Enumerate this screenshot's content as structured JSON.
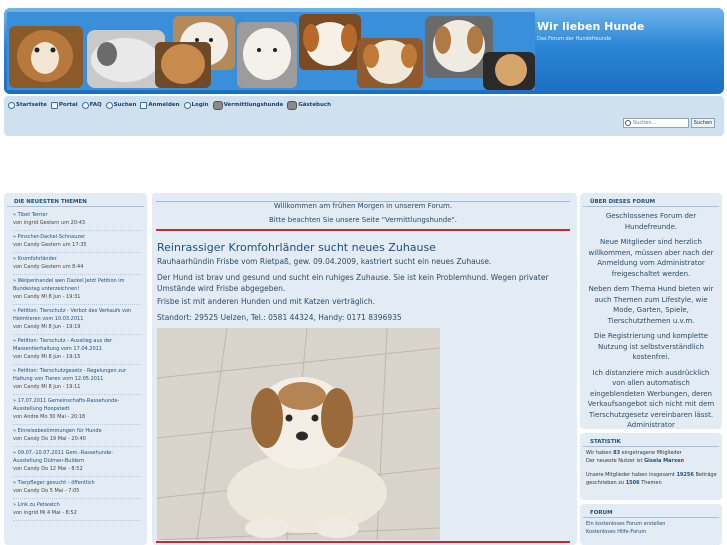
{
  "header": {
    "title": "Wir lieben Hunde",
    "description": "Das Forum der Hundefreunde"
  },
  "nav": {
    "items": [
      {
        "label": "Startseite",
        "icon": "home-icon"
      },
      {
        "label": "Portal",
        "icon": "portal-icon"
      },
      {
        "label": "FAQ",
        "icon": "help-icon"
      },
      {
        "label": "Suchen",
        "icon": "search-icon"
      },
      {
        "label": "Anmelden",
        "icon": "register-icon"
      },
      {
        "label": "Login",
        "icon": "login-icon"
      },
      {
        "label": "Vermittlungshunde",
        "icon": "dog-icon"
      },
      {
        "label": "Gästebuch",
        "icon": "dog-icon"
      }
    ],
    "search_placeholder": "Suchen...",
    "search_button": "Suchen"
  },
  "left": {
    "title": "DIE NEUESTEN THEMEN",
    "topics": [
      {
        "title": "» Tibet Terrier",
        "meta": "von ingrid Gestern um 20:43"
      },
      {
        "title": "» Pinscher-Dackel-Schnauzer",
        "meta": "von Candy Gestern um 17:35"
      },
      {
        "title": "» Kromfohrländer",
        "meta": "von Candy Gestern um 8:44"
      },
      {
        "title": "» Welpenhandel wen Dackel Jetzt Petition im Bundestag unterzeichnen!",
        "meta": "von Candy Mi 8 Jun - 19:31"
      },
      {
        "title": "» Petition: Tierschutz - Verbot des Verkaufs von Heimtieren vom 10.03.2011",
        "meta": "von Candy Mi 8 Jun - 19:19"
      },
      {
        "title": "» Petition: Tierschutz - Ausstieg aus der Massentierhaltung vom 17.04.2011",
        "meta": "von Candy Mi 8 Jun - 19:15"
      },
      {
        "title": "» Petition: Tierschutzgesetz - Regelungen zur Haltung von Tieren vom 12.05.2011",
        "meta": "von Candy Mi 8 Jun - 19:11"
      },
      {
        "title": "» 17.07.2011 Gemeinschafts-Rassehunde-Ausstellung Hoopstedt",
        "meta": "von Andre Mo 30 Mai - 20:18"
      },
      {
        "title": "» Einreisebestimmungen für Hunde",
        "meta": "von Candy Do 19 Mai - 20:40"
      },
      {
        "title": "» 09.07.-10.07.2011 Gem.-Rassehunde-Ausstellung Dülmen-Buldern",
        "meta": "von Candy Do 12 Mai - 8:52"
      },
      {
        "title": "» Tierpfleger gesucht - öffentlich",
        "meta": "von Candy Do 5 Mai - 7:05"
      },
      {
        "title": "» Link zu Petwatch",
        "meta": "von ingrid Mi 4 Mai - 8:52"
      }
    ]
  },
  "main": {
    "welcome1": "Willkommen am frühen Morgen in unserem Forum.",
    "welcome2": "Bitte beachten Sie unsere Seite \"Vermittlungshunde\".",
    "post_title": "Reinrassiger Kromfohrländer sucht neues Zuhause",
    "lines": [
      "Rauhaarhündin Frisbe vom Rietpaß, gew. 09.04.2009, kastriert sucht ein neues Zuhause.",
      "Der Hund ist brav und gesund und sucht ein ruhiges Zuhause. Sie ist kein Problemhund. Wegen privater Umstände wird Frisbe abgegeben.",
      "Frisbe ist mit anderen Hunden und mit Katzen verträglich.",
      "Standort: 29525 Uelzen, Tel.: 0581 44324, Handy: 0171 8396935"
    ]
  },
  "about": {
    "title": "ÜBER DIESES FORUM",
    "paragraphs": [
      "Geschlossenes Forum der Hundefreunde.",
      "Neue Mitglieder sind herzlich willkommen, müssen aber nach der Anmeldung vom Administrator freigeschaltet werden.",
      "Neben dem Thema Hund bieten wir auch Themen zum Lifestyle, wie Mode, Garten, Spiele, Tierschutzthemen u.v.m.",
      "Die Registrierung und komplette Nutzung ist selbstverständlich kostenfrei.",
      "Ich distanziere mich ausdrücklich von allen automatisch eingeblendeten Werbungen, deren Verkaufsangebot sich nicht mit dem Tierschutzgesetz vereinbaren lässt. Administrator"
    ]
  },
  "stats": {
    "title": "STATISTIK",
    "members_pre": "Wir haben ",
    "members_count": "83",
    "members_post": " eingetragene Mitglieder",
    "newest_pre": "Der neueste Nutzer ist ",
    "newest_user": "Gisela Marxen",
    "posts_pre": "Unsere Mitglieder haben insgesamt ",
    "posts_count": "19256",
    "posts_mid": " Beiträge geschrieben zu ",
    "topics_count": "1506",
    "topics_post": " Themen"
  },
  "forum": {
    "title": "FORUM",
    "link1": "Ein kostenloses Forum erstellen",
    "link2": "Kostenloses Hilfe-Forum"
  },
  "colors": {
    "accent": "#1f4e7a",
    "header_blue": "#2b86d6",
    "rule_red": "#c42d2d",
    "panel": "#e3ecf4"
  }
}
